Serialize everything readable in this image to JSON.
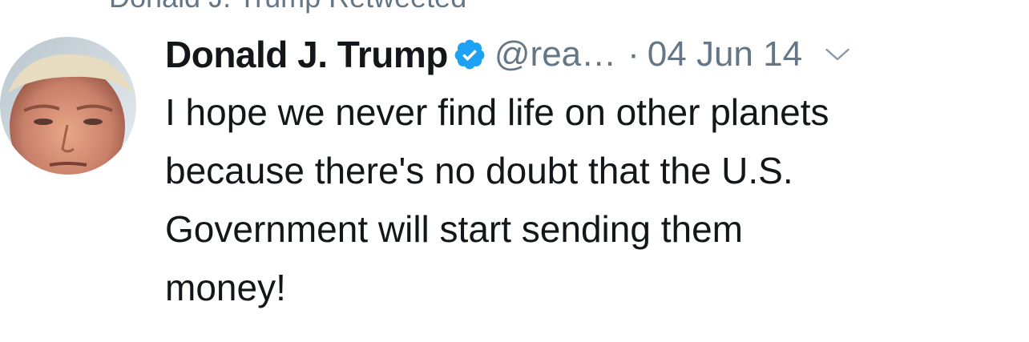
{
  "retweet_context": "Donald J. Trump Retweeted",
  "tweet": {
    "author": {
      "display_name": "Donald J. Trump",
      "verified": true,
      "handle": "@rea…",
      "avatar_icon": "user-avatar"
    },
    "separator": "·",
    "timestamp": "04 Jun 14",
    "menu_icon": "chevron-down-icon",
    "text": "I hope we never find life on other planets\nbecause there's no doubt that the U.S.\nGovernment will start sending them\nmoney!"
  },
  "colors": {
    "text_primary": "#14171a",
    "text_secondary": "#657786",
    "verified_blue": "#1da1f2"
  }
}
